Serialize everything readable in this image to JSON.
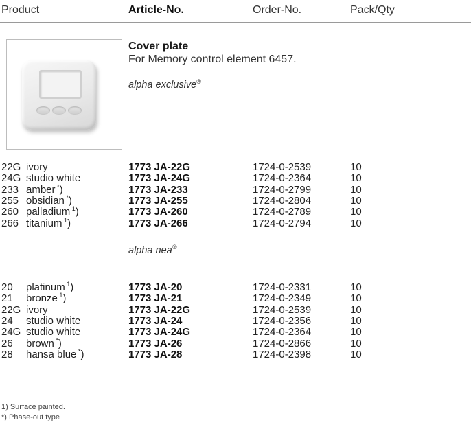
{
  "header": {
    "product": "Product",
    "article": "Article-No.",
    "order": "Order-No.",
    "pack": "Pack/Qty"
  },
  "product": {
    "title": "Cover plate",
    "subtitle": "For Memory control element 6457.",
    "image_icon": "cover-plate-icon"
  },
  "series1": {
    "name": "alpha exclusive",
    "mark": "®"
  },
  "rows1": [
    {
      "code": "22G",
      "name": "ivory",
      "note": "",
      "article": "1773 JA-22G",
      "order": "1724-0-2539",
      "qty": "10"
    },
    {
      "code": "24G",
      "name": "studio white",
      "note": "",
      "article": "1773 JA-24G",
      "order": "1724-0-2364",
      "qty": "10"
    },
    {
      "code": "233",
      "name": "amber",
      "note": "*",
      "article": "1773 JA-233",
      "order": "1724-0-2799",
      "qty": "10"
    },
    {
      "code": "255",
      "name": "obsidian",
      "note": "*",
      "article": "1773 JA-255",
      "order": "1724-0-2804",
      "qty": "10"
    },
    {
      "code": "260",
      "name": "palladium",
      "note": "1",
      "article": "1773 JA-260",
      "order": "1724-0-2789",
      "qty": "10"
    },
    {
      "code": "266",
      "name": "titanium",
      "note": "1",
      "article": "1773 JA-266",
      "order": "1724-0-2794",
      "qty": "10"
    }
  ],
  "series2": {
    "name": "alpha nea",
    "mark": "®"
  },
  "rows2": [
    {
      "code": "20",
      "name": "platinum",
      "note": "1",
      "article": "1773 JA-20",
      "order": "1724-0-2331",
      "qty": "10"
    },
    {
      "code": "21",
      "name": "bronze",
      "note": "1",
      "article": "1773 JA-21",
      "order": "1724-0-2349",
      "qty": "10"
    },
    {
      "code": "22G",
      "name": "ivory",
      "note": "",
      "article": "1773 JA-22G",
      "order": "1724-0-2539",
      "qty": "10"
    },
    {
      "code": "24",
      "name": "studio white",
      "note": "",
      "article": "1773 JA-24",
      "order": "1724-0-2356",
      "qty": "10"
    },
    {
      "code": "24G",
      "name": "studio white",
      "note": "",
      "article": "1773 JA-24G",
      "order": "1724-0-2364",
      "qty": "10"
    },
    {
      "code": "26",
      "name": "brown",
      "note": "*",
      "article": "1773 JA-26",
      "order": "1724-0-2866",
      "qty": "10"
    },
    {
      "code": "28",
      "name": "hansa blue",
      "note": "*",
      "article": "1773 JA-28",
      "order": "1724-0-2398",
      "qty": "10"
    }
  ],
  "footnotes": [
    "1)  Surface painted.",
    "*)  Phase-out type"
  ]
}
